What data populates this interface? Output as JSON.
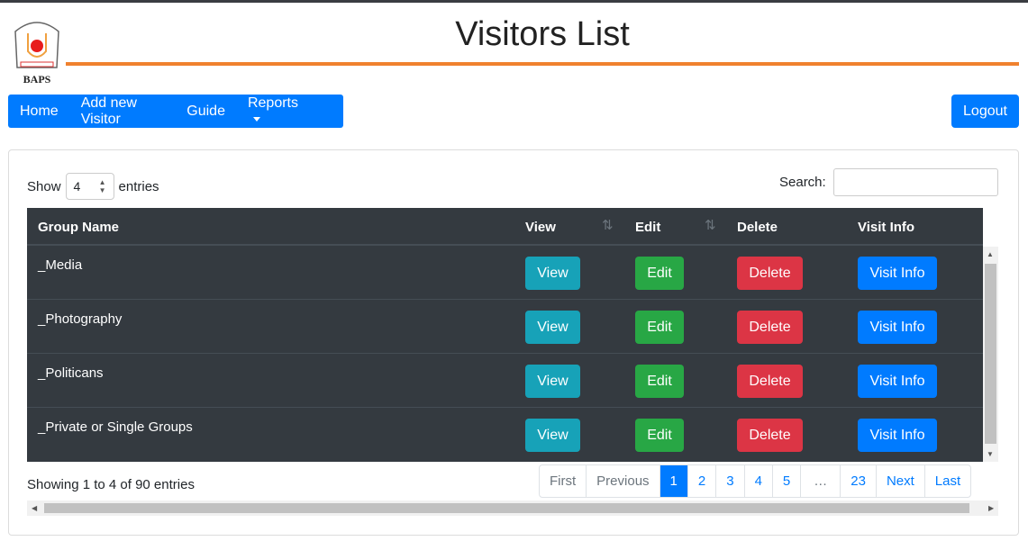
{
  "header": {
    "title": "Visitors List",
    "logo_text": "BAPS"
  },
  "nav": {
    "items": [
      "Home",
      "Add new Visitor",
      "Guide",
      "Reports"
    ],
    "logout": "Logout"
  },
  "controls": {
    "show_label": "Show",
    "entries_value": "4",
    "entries_label": "entries",
    "search_label": "Search:",
    "search_value": ""
  },
  "table": {
    "columns": [
      "Group Name",
      "View",
      "Edit",
      "Delete",
      "Visit Info"
    ],
    "rows": [
      {
        "group": "_Media",
        "view": "View",
        "edit": "Edit",
        "delete": "Delete",
        "visit": "Visit Info"
      },
      {
        "group": "_Photography",
        "view": "View",
        "edit": "Edit",
        "delete": "Delete",
        "visit": "Visit Info"
      },
      {
        "group": "_Politicans",
        "view": "View",
        "edit": "Edit",
        "delete": "Delete",
        "visit": "Visit Info"
      },
      {
        "group": "_Private or Single Groups",
        "view": "View",
        "edit": "Edit",
        "delete": "Delete",
        "visit": "Visit Info"
      }
    ]
  },
  "footer": {
    "info": "Showing 1 to 4 of 90 entries",
    "pages": [
      "First",
      "Previous",
      "1",
      "2",
      "3",
      "4",
      "5",
      "…",
      "23",
      "Next",
      "Last"
    ],
    "active_page": "1"
  }
}
